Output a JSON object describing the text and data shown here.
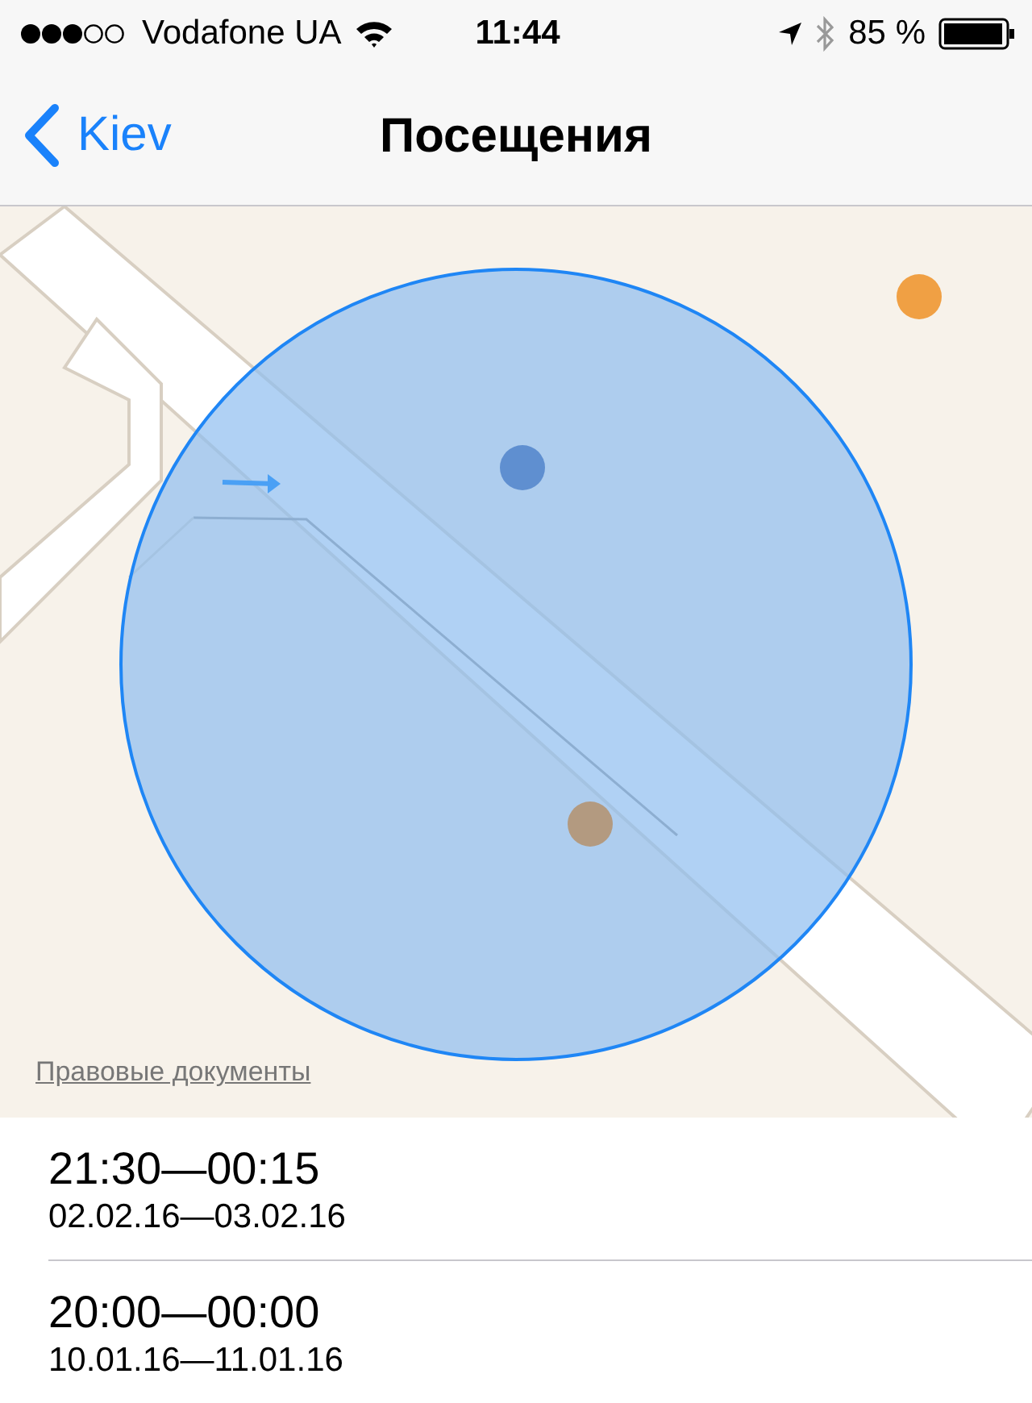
{
  "status_bar": {
    "carrier": "Vodafone UA",
    "time": "11:44",
    "battery": "85 %"
  },
  "nav": {
    "back": "Kiev",
    "title": "Посещения"
  },
  "map": {
    "kind": "picture",
    "legal_link": "Правовые документы"
  },
  "visits": [
    {
      "time": "21:30—00:15",
      "dates": "02.02.16—03.02.16"
    },
    {
      "time": "20:00—00:00",
      "dates": "10.01.16—11.01.16"
    }
  ]
}
